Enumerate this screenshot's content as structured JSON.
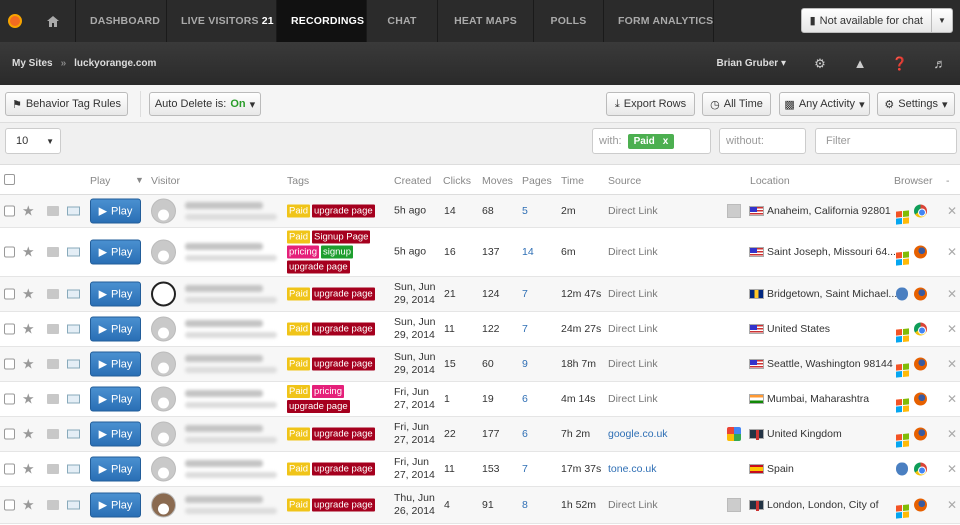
{
  "nav": {
    "items": [
      {
        "label": "DASHBOARD",
        "name": "nav-dashboard"
      },
      {
        "label": "LIVE VISITORS",
        "badge": "21",
        "name": "nav-live-visitors"
      },
      {
        "label": "RECORDINGS",
        "name": "nav-recordings",
        "active": true
      },
      {
        "label": "CHAT",
        "name": "nav-chat"
      },
      {
        "label": "HEAT MAPS",
        "name": "nav-heat-maps"
      },
      {
        "label": "POLLS",
        "name": "nav-polls"
      },
      {
        "label": "FORM ANALYTICS",
        "name": "nav-form-analytics"
      }
    ],
    "chat_status": "Not available for chat"
  },
  "subbar": {
    "crumb_root": "My Sites",
    "crumb_site": "luckyorange.com",
    "user": "Brian Gruber"
  },
  "toolbar": {
    "behavior_tag_rules": "Behavior Tag Rules",
    "auto_delete_label": "Auto Delete is:",
    "auto_delete_value": "On",
    "export_rows": "Export Rows",
    "all_time": "All Time",
    "any_activity": "Any Activity",
    "settings": "Settings"
  },
  "filters": {
    "per_page": "10",
    "with_label": "with:",
    "with_chip": "Paid",
    "without_placeholder": "without:",
    "filter_placeholder": "Filter"
  },
  "columns": {
    "play": "Play",
    "visitor": "Visitor",
    "tags": "Tags",
    "created": "Created",
    "clicks": "Clicks",
    "moves": "Moves",
    "pages": "Pages",
    "time": "Time",
    "source": "Source",
    "location": "Location",
    "browser": "Browser",
    "dash": "-"
  },
  "play_label": "Play",
  "rows": [
    {
      "tags": [
        [
          "Paid",
          "yellow"
        ],
        [
          "upgrade page",
          "red"
        ]
      ],
      "created": [
        "5h ago"
      ],
      "clicks": "14",
      "moves": "68",
      "pages": "5",
      "time": "2m",
      "source": "Direct Link",
      "src_link": false,
      "src_icon": "gray",
      "flag": "us",
      "location": "Anaheim, California 92801",
      "os": "win",
      "browser": "chrome"
    },
    {
      "tags": [
        [
          "Paid",
          "yellow"
        ],
        [
          "Signup Page",
          "red"
        ],
        [
          "pricing",
          "pink"
        ],
        [
          "signup",
          "green"
        ],
        [
          "upgrade page",
          "red"
        ]
      ],
      "created": [
        "5h ago"
      ],
      "clicks": "16",
      "moves": "137",
      "pages": "14",
      "time": "6m",
      "source": "Direct Link",
      "src_link": false,
      "src_icon": "none",
      "flag": "us",
      "location": "Saint Joseph, Missouri 64...",
      "os": "win",
      "browser": "firefox"
    },
    {
      "tags": [
        [
          "Paid",
          "yellow"
        ],
        [
          "upgrade page",
          "red"
        ]
      ],
      "created": [
        "Sun, Jun",
        "29, 2014"
      ],
      "clicks": "21",
      "moves": "124",
      "pages": "7",
      "time": "12m 47s",
      "source": "Direct Link",
      "src_link": false,
      "src_icon": "none",
      "flag": "bb",
      "location": "Bridgetown, Saint Michael...",
      "os": "mac",
      "browser": "firefox",
      "avatar": "helmet"
    },
    {
      "tags": [
        [
          "Paid",
          "yellow"
        ],
        [
          "upgrade page",
          "red"
        ]
      ],
      "created": [
        "Sun, Jun",
        "29, 2014"
      ],
      "clicks": "11",
      "moves": "122",
      "pages": "7",
      "time": "24m 27s",
      "source": "Direct Link",
      "src_link": false,
      "src_icon": "none",
      "flag": "us",
      "location": "United States",
      "os": "win",
      "browser": "chrome"
    },
    {
      "tags": [
        [
          "Paid",
          "yellow"
        ],
        [
          "upgrade page",
          "red"
        ]
      ],
      "created": [
        "Sun, Jun",
        "29, 2014"
      ],
      "clicks": "15",
      "moves": "60",
      "pages": "9",
      "time": "18h 7m",
      "source": "Direct Link",
      "src_link": false,
      "src_icon": "none",
      "flag": "us",
      "location": "Seattle, Washington 98144",
      "os": "win",
      "browser": "firefox"
    },
    {
      "tags": [
        [
          "Paid",
          "yellow"
        ],
        [
          "pricing",
          "pink"
        ],
        [
          "upgrade page",
          "red"
        ]
      ],
      "created": [
        "Fri, Jun",
        "27, 2014"
      ],
      "clicks": "1",
      "moves": "19",
      "pages": "6",
      "time": "4m 14s",
      "source": "Direct Link",
      "src_link": false,
      "src_icon": "none",
      "flag": "in",
      "location": "Mumbai, Maharashtra",
      "os": "win",
      "browser": "firefox"
    },
    {
      "tags": [
        [
          "Paid",
          "yellow"
        ],
        [
          "upgrade page",
          "red"
        ]
      ],
      "created": [
        "Fri, Jun",
        "27, 2014"
      ],
      "clicks": "22",
      "moves": "177",
      "pages": "6",
      "time": "7h 2m",
      "source": "google.co.uk",
      "src_link": true,
      "src_icon": "google",
      "flag": "gb",
      "location": "United Kingdom",
      "os": "win",
      "browser": "firefox"
    },
    {
      "tags": [
        [
          "Paid",
          "yellow"
        ],
        [
          "upgrade page",
          "red"
        ]
      ],
      "created": [
        "Fri, Jun",
        "27, 2014"
      ],
      "clicks": "11",
      "moves": "153",
      "pages": "7",
      "time": "17m 37s",
      "source": "tone.co.uk",
      "src_link": true,
      "src_icon": "none",
      "flag": "es",
      "location": "Spain",
      "os": "mac",
      "browser": "chrome"
    },
    {
      "tags": [
        [
          "Paid",
          "yellow"
        ],
        [
          "upgrade page",
          "red"
        ]
      ],
      "created": [
        "Thu, Jun",
        "26, 2014"
      ],
      "clicks": "4",
      "moves": "91",
      "pages": "8",
      "time": "1h 52m",
      "source": "Direct Link",
      "src_link": false,
      "src_icon": "gray",
      "flag": "gb",
      "location": "London, London, City of",
      "os": "win",
      "browser": "firefox",
      "avatar": "photo"
    }
  ]
}
